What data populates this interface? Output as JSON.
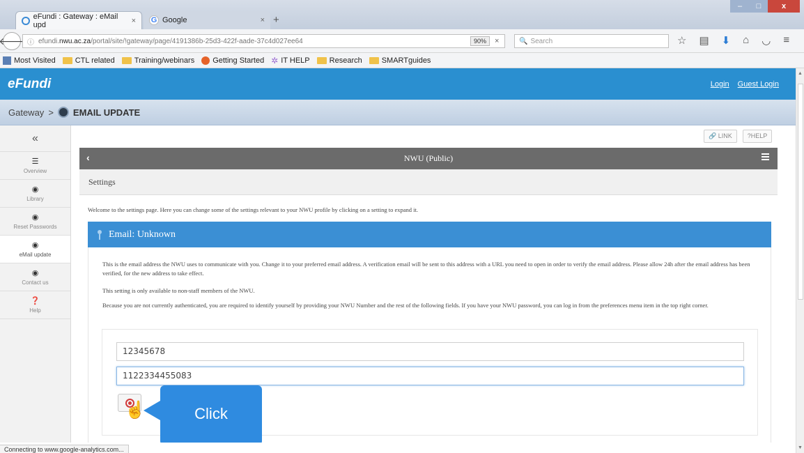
{
  "browser": {
    "tabs": [
      {
        "label": "eFundi : Gateway : eMail upd",
        "close": "×"
      },
      {
        "label": "Google",
        "close": "×"
      }
    ],
    "new_tab": "+",
    "url_prefix": "efundi.",
    "url_domain": "nwu.ac.za",
    "url_path": "/portal/site/!gateway/page/4191386b-25d3-422f-aade-37c4d027ee64",
    "zoom": "90%",
    "clear": "×",
    "search_placeholder": "Search",
    "window_controls": {
      "minimize": "–",
      "maximize": "□",
      "close": "x"
    }
  },
  "bookmarks": [
    "Most Visited",
    "CTL related",
    "Training/webinars",
    "Getting Started",
    "IT HELP",
    "Research",
    "SMARTguides"
  ],
  "site": {
    "logo": "eFundi",
    "login": "Login",
    "guest_login": "Guest Login"
  },
  "breadcrumb": {
    "root": "Gateway",
    "separator": ">",
    "current": "EMAIL UPDATE"
  },
  "sidebar": {
    "collapse": "«",
    "items": [
      {
        "label": "Overview",
        "icon": "list-icon"
      },
      {
        "label": "Library",
        "icon": "globe-icon"
      },
      {
        "label": "Reset Passwords",
        "icon": "globe-icon"
      },
      {
        "label": "eMail update",
        "icon": "globe-icon"
      },
      {
        "label": "Contact us",
        "icon": "globe-icon"
      },
      {
        "label": "Help",
        "icon": "help-icon"
      }
    ]
  },
  "tools": {
    "link": "LINK",
    "help": "HELP"
  },
  "tool": {
    "back": "‹",
    "title": "NWU (Public)",
    "section": "Settings",
    "welcome": "Welcome to the settings page. Here you can change some of the settings relevant to your NWU profile by clicking on a setting to expand it."
  },
  "email": {
    "header": "Email: Unknown",
    "p1": "This is the email address the NWU uses to communicate with you. Change it to your preferred email address. A verification email will be sent to this address with a URL you need to open in order to verify the email address. Please allow 24h after the email address has been verified, for the new address to take effect.",
    "p2": "This setting is only available to non-staff members of the NWU.",
    "p3": "Because you are not currently authenticated, you are required to identify yourself by providing your NWU Number and the rest of the following fields. If you have your NWU password, you can log in from the preferences menu item in the top right corner.",
    "nwu_number": "12345678",
    "id_number": "1122334455083"
  },
  "callout": "Click",
  "status": "Connecting to www.google-analytics.com...",
  "colors": {
    "site_header": "#2a8fd0",
    "tool_header": "#6b6b6b",
    "email_bar": "#3b8fd4",
    "callout": "#2f8be0"
  }
}
